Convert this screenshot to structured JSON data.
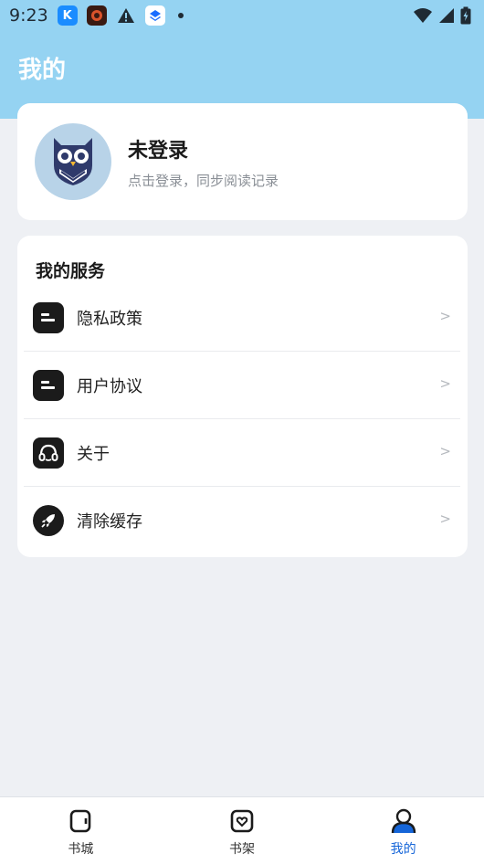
{
  "status_bar": {
    "time": "9:23",
    "app_badges": [
      "K",
      "●",
      "▲",
      "◆"
    ]
  },
  "header": {
    "title": "我的"
  },
  "profile": {
    "name": "未登录",
    "subtitle": "点击登录，同步阅读记录"
  },
  "services": {
    "title": "我的服务",
    "items": [
      {
        "label": "隐私政策",
        "icon": "document-icon",
        "arrow": ">"
      },
      {
        "label": "用户协议",
        "icon": "document-icon",
        "arrow": ">"
      },
      {
        "label": "关于",
        "icon": "headset-icon",
        "arrow": ">"
      },
      {
        "label": "清除缓存",
        "icon": "rocket-icon",
        "arrow": ">"
      }
    ]
  },
  "bottom_nav": {
    "items": [
      {
        "label": "书城",
        "icon": "book-store-icon",
        "active": false
      },
      {
        "label": "书架",
        "icon": "bookshelf-heart-icon",
        "active": false
      },
      {
        "label": "我的",
        "icon": "profile-icon",
        "active": true
      }
    ]
  },
  "colors": {
    "header_bg": "#95d3f2",
    "page_bg": "#eef0f4",
    "active_nav": "#1565d8"
  }
}
